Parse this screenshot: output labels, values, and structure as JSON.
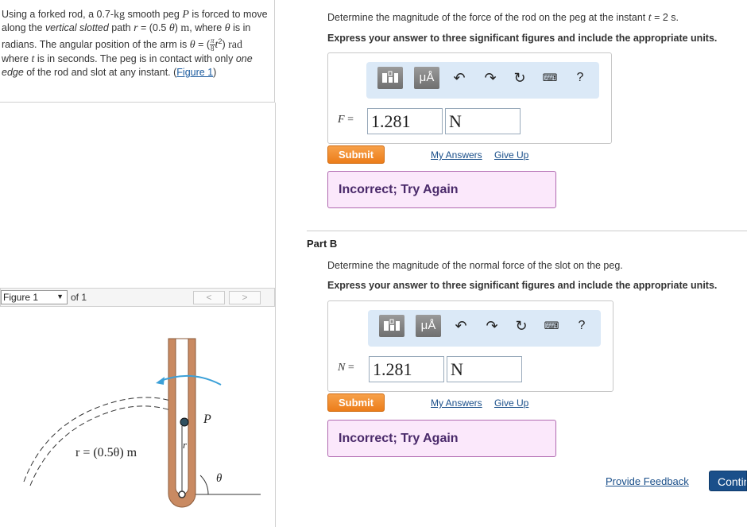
{
  "problem": {
    "s1": "Using a forked rod, a 0.7-",
    "kg": "kg",
    "s2": " smooth peg ",
    "P": "P",
    "s3": " is forced to move along the ",
    "vertical_slotted": "vertical slotted",
    "s4": " path ",
    "r": "r",
    "s5": " = (0.5 ",
    "theta": "θ",
    "s6": ") ",
    "m": "m",
    "s7": ", where ",
    "s8": " is in radians. The angular position of the arm is ",
    "s9": " = (",
    "pi": "π",
    "eight": "8",
    "t2": "t",
    "sq": "2",
    "s10": ") ",
    "rad": "rad",
    "s11": " where ",
    "t": "t",
    "s12": " is in seconds. The peg is in contact with only ",
    "one_edge": "one edge",
    "s13": " of the rod and slot at any instant. (",
    "figure_link": "Figure 1",
    "s14": ")"
  },
  "figure_nav": {
    "select_value": "Figure 1",
    "of_label": "of 1",
    "prev": "<",
    "next": ">"
  },
  "figure": {
    "label_P": "P",
    "label_r": "r",
    "label_eq": "r = (0.5θ) m",
    "label_theta": "θ"
  },
  "partA": {
    "question": "Determine the magnitude of the force of the rod on the peg at the instant ",
    "t_var": "t",
    "t_val": " = 2 s.",
    "instruction": "Express your answer to three significant figures and include the appropriate units.",
    "var_name": "F",
    "var_eq": " =",
    "value": "1.281",
    "unit": "N",
    "submit": "Submit",
    "my_answers": "My Answers",
    "give_up": "Give Up",
    "feedback": "Incorrect; Try Again"
  },
  "partB": {
    "title": "Part B",
    "question": "Determine the magnitude of the normal force of the slot on the peg.",
    "instruction": "Express your answer to three significant figures and include the appropriate units.",
    "var_name": "N",
    "var_eq": " =",
    "value": "1.281",
    "unit": "N",
    "submit": "Submit",
    "my_answers": "My Answers",
    "give_up": "Give Up",
    "feedback": "Incorrect; Try Again"
  },
  "toolbar": {
    "units_label": "μÅ",
    "help_label": "?",
    "icons": [
      "templates-icon",
      "units-icon",
      "undo-icon",
      "redo-icon",
      "reset-icon",
      "keyboard-icon",
      "help-icon"
    ]
  },
  "footer": {
    "provide_feedback": "Provide Feedback",
    "continue": "Continue"
  },
  "colors": {
    "submit": "#ec7d1a",
    "toolbar_bg": "#dbe9f7",
    "feedback_bg": "#fbe8fb",
    "link": "#1a4f8a",
    "rod": "#c98a62",
    "arrow": "#3ba0d8"
  }
}
